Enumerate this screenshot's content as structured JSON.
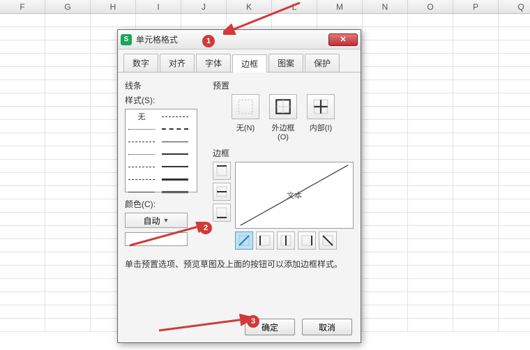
{
  "columns": [
    "F",
    "G",
    "H",
    "I",
    "J",
    "K",
    "L",
    "M",
    "N",
    "O",
    "P",
    "Q"
  ],
  "dialog": {
    "title": "单元格格式",
    "tabs": {
      "t0": "数字",
      "t1": "对齐",
      "t2": "字体",
      "t3": "边框",
      "t4": "图案",
      "t5": "保护"
    },
    "line_section": "线条",
    "style_label": "样式(S):",
    "style_none": "无",
    "preset_section": "预置",
    "presets": {
      "none": "无(N)",
      "outer": "外边框(O)",
      "inner": "内部(I)"
    },
    "border_section": "边框",
    "preview_text": "文本",
    "color_label": "颜色(C):",
    "color_auto": "自动",
    "hint": "单击预置选项、预览草图及上面的按钮可以添加边框样式。",
    "ok": "确定",
    "cancel": "取消"
  },
  "annotations": {
    "n1": "1",
    "n2": "2",
    "n3": "3"
  }
}
